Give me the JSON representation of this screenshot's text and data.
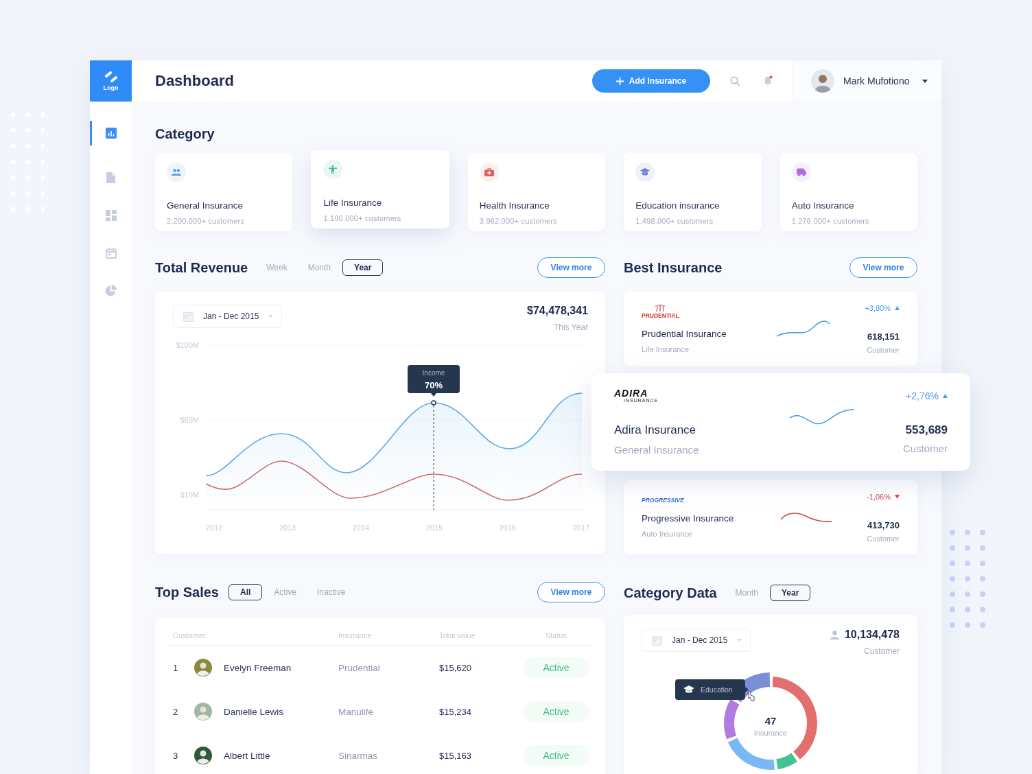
{
  "logo": {
    "text": "Logo"
  },
  "header": {
    "title": "Dashboard",
    "add_button": "Add Insurance",
    "notifications": {
      "unread": true
    },
    "user": {
      "name": "Mark Mufotiono"
    }
  },
  "sidebar": {
    "items": [
      {
        "selected": true
      },
      {
        "selected": false
      },
      {
        "selected": false
      },
      {
        "selected": false
      },
      {
        "selected": false
      }
    ]
  },
  "category": {
    "title": "Category",
    "items": [
      {
        "name": "General Insurance",
        "customers": "2.200.000+ customers",
        "color": "#5a9ee8",
        "selected": false
      },
      {
        "name": "Life Insurance",
        "customers": "1.100.000+ customers",
        "color": "#3bbf8c",
        "selected": true
      },
      {
        "name": "Health Insurance",
        "customers": "3.962.000+ customers",
        "color": "#e0605f",
        "selected": false
      },
      {
        "name": "Education insurance",
        "customers": "1.498.000+ customers",
        "color": "#6d7fd6",
        "selected": false
      },
      {
        "name": "Auto Insurance",
        "customers": "1.276.000+ customers",
        "color": "#b06de0",
        "selected": false
      }
    ]
  },
  "total_revenue": {
    "title": "Total Revenue",
    "tabs": [
      {
        "label": "Week",
        "selected": false
      },
      {
        "label": "Month",
        "selected": false
      },
      {
        "label": "Year",
        "selected": true
      }
    ],
    "view_more": "View more",
    "date_range": "Jan - Dec 2015",
    "total": "$74,478,341",
    "total_label": "This Year",
    "y_labels": [
      "$100M",
      "$50M",
      "$10M"
    ],
    "x_labels": [
      "2012",
      "2013",
      "2014",
      "2015",
      "2016",
      "2017"
    ],
    "tooltip": {
      "label": "Income",
      "value": "70%"
    }
  },
  "best_insurance": {
    "title": "Best Insurance",
    "view_more": "View more",
    "items": [
      {
        "logo": "PRUDENTIAL",
        "name": "Prudential Insurance",
        "type": "Life Insurance",
        "change": "+3,80%",
        "rising": true,
        "count": "618,151",
        "count_label": "Customer",
        "selected": false
      },
      {
        "logo": "ADIRA",
        "logo_sub": "INSURANCE",
        "name": "Adira Insurance",
        "type": "General Insurance",
        "change": "+2,76%",
        "rising": true,
        "count": "553,689",
        "count_label": "Customer",
        "selected": true
      },
      {
        "logo": "PROGRESSIVE",
        "name": "Progressive Insurance",
        "type": "Auto Insurance",
        "change": "-1,06%",
        "rising": false,
        "count": "413,730",
        "count_label": "Customer",
        "selected": false
      }
    ]
  },
  "top_sales": {
    "title": "Top Sales",
    "tabs": [
      {
        "label": "All",
        "selected": true
      },
      {
        "label": "Active",
        "selected": false
      },
      {
        "label": "Inactive",
        "selected": false
      }
    ],
    "view_more": "View more",
    "columns": [
      "Customer",
      "Insurance",
      "Total value",
      "Status"
    ],
    "rows": [
      {
        "number": "1",
        "name": "Evelyn Freeman",
        "insurance": "Prudential",
        "value": "$15,620",
        "status": "Active"
      },
      {
        "number": "2",
        "name": "Danielle Lewis",
        "insurance": "Manulife",
        "value": "$15,234",
        "status": "Active"
      },
      {
        "number": "3",
        "name": "Albert Little",
        "insurance": "Sinarmas",
        "value": "$15,163",
        "status": "Active"
      }
    ]
  },
  "category_data": {
    "title": "Category Data",
    "tabs": [
      {
        "label": "Month",
        "selected": false
      },
      {
        "label": "Year",
        "selected": true
      }
    ],
    "date_range": "Jan - Dec 2015",
    "total": "10,134,478",
    "total_label": "Customer",
    "center_value": "47",
    "center_label": "Insurance",
    "tooltip": "Education"
  }
}
